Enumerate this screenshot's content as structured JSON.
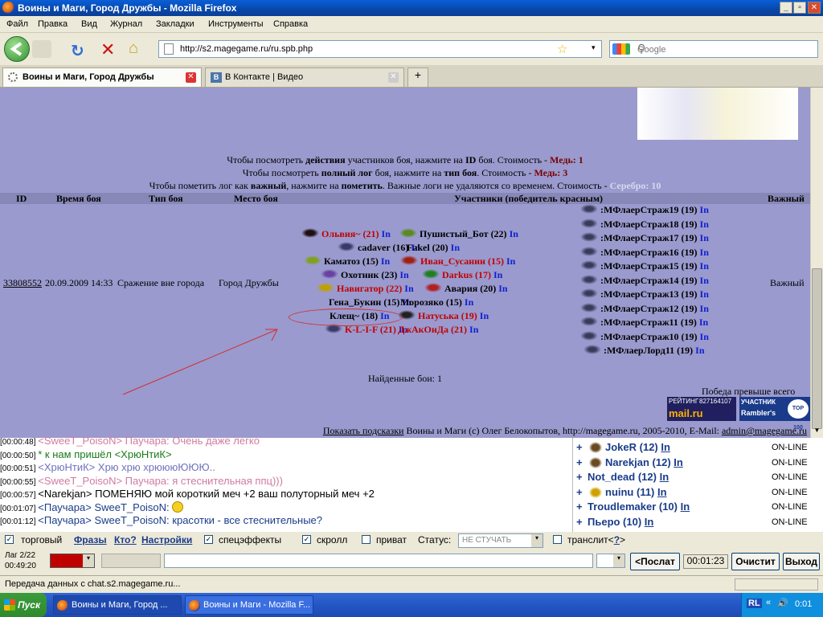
{
  "window": {
    "title": "Воины и Маги, Город Дружбы - Mozilla Firefox"
  },
  "menu": [
    "Файл",
    "Правка",
    "Вид",
    "Журнал",
    "Закладки",
    "Инструменты",
    "Справка"
  ],
  "nav": {
    "url": "http://s2.magegame.ru/ru.spb.php",
    "search_placeholder": "Google"
  },
  "tabs": [
    {
      "label": "Воины и Маги, Город Дружбы"
    },
    {
      "label": "В Контакте | Видео"
    }
  ],
  "game": {
    "info1": {
      "pre": "Чтобы посмотреть ",
      "b1": "действия",
      "mid": " участников боя, нажмите на ",
      "b2": "ID",
      "post": " боя. Стоимость - ",
      "cost": "Медь: 1"
    },
    "info2": {
      "pre": "Чтобы посмотреть ",
      "b1": "полный лог",
      "mid": " боя, нажмите на ",
      "b2": "тип боя",
      "post": ". Стоимость - ",
      "cost": "Медь: 3"
    },
    "info3": {
      "pre": "Чтобы пометить лог как ",
      "b1": "важный",
      "mid": ", нажмите на ",
      "b2": "пометить",
      "post": ". Важные логи не удаляются со временем. Стоимость - ",
      "cost": "Серебро: 10"
    },
    "headers": {
      "id": "ID",
      "time": "Время боя",
      "type": "Тип боя",
      "place": "Место боя",
      "members": "Участники (победитель красным)",
      "important": "Важный"
    },
    "row": {
      "id": "33808552",
      "time": "20.09.2009 14:33",
      "type": "Сражение вне города",
      "place": "Город Дружбы",
      "important": "Важный"
    },
    "fighters": [
      {
        "name": "Ольвия~",
        "level": "(21)",
        "red": true
      },
      {
        "name": "Пушистый_Бот",
        "level": "(22)",
        "red": false
      },
      {
        "name": "cadaver",
        "level": "(16)",
        "red": false
      },
      {
        "name": "Fakel",
        "level": "(20)",
        "red": false
      },
      {
        "name": "Каматоз",
        "level": "(15)",
        "red": false
      },
      {
        "name": "Иван_Сусанин",
        "level": "(15)",
        "red": true
      },
      {
        "name": "Охотник",
        "level": "(23)",
        "red": false
      },
      {
        "name": "Darkus",
        "level": "(17)",
        "red": true
      },
      {
        "name": "Навигатор",
        "level": "(22)",
        "red": true
      },
      {
        "name": "Авария",
        "level": "(20)",
        "red": false
      },
      {
        "name": "Гена_Букин",
        "level": "(15)",
        "red": false
      },
      {
        "name": "Морозяко",
        "level": "(15)",
        "red": false
      },
      {
        "name": "Клещ~",
        "level": "(18)",
        "red": false
      },
      {
        "name": "Натуська",
        "level": "(19)",
        "red": true
      },
      {
        "name": "K-L-I-F",
        "level": "(21)",
        "red": true
      },
      {
        "name": "ДжАкОнДа",
        "level": "(21)",
        "red": true
      }
    ],
    "link_in": "In",
    "guards": [
      {
        "name": ":МФлаерСтраж19",
        "level": "(19)"
      },
      {
        "name": ":МФлаерСтраж18",
        "level": "(19)"
      },
      {
        "name": ":МФлаерСтраж17",
        "level": "(19)"
      },
      {
        "name": ":МФлаерСтраж16",
        "level": "(19)"
      },
      {
        "name": ":МФлаерСтраж15",
        "level": "(19)"
      },
      {
        "name": ":МФлаерСтраж14",
        "level": "(19)"
      },
      {
        "name": ":МФлаерСтраж13",
        "level": "(19)"
      },
      {
        "name": ":МФлаерСтраж12",
        "level": "(19)"
      },
      {
        "name": ":МФлаерСтраж11",
        "level": "(19)"
      },
      {
        "name": ":МФлаерСтраж10",
        "level": "(19)"
      },
      {
        "name": ":МФлаерЛорд11",
        "level": "(19)"
      }
    ],
    "found": "Найденные бои: 1",
    "win_text": "Победа превыше всего",
    "mailru": {
      "label": "РЕЙТИНГ",
      "num": "827164107",
      "brand": "mail.ru"
    },
    "rambler": {
      "top": "УЧАСТНИК",
      "brand": "Rambler's",
      "badge": "TOP 100"
    },
    "footer": {
      "link": "Показать подсказки",
      "text": " Воины и Маги (c) Олег Белокопытов, http://magegame.ru, 2005-2010, E-Mail: ",
      "email": "admin@magegame.ru"
    }
  },
  "chat": [
    {
      "ts": "[00:00:48]",
      "nick": "<SweeT_PoisoN>",
      "text": " Паучара: Очень даже легко",
      "color": "#d07aa0"
    },
    {
      "ts": "[00:00:50]",
      "nick": "",
      "text": "* к нам пришёл <ХрюНтиК>",
      "color": "#1a7a1a"
    },
    {
      "ts": "[00:00:51]",
      "nick": "<ХрюНтиК>",
      "text": " Хрю хрю хрюююЮЮЮ..",
      "color": "#7070c0"
    },
    {
      "ts": "[00:00:55]",
      "nick": "<SweeT_PoisoN>",
      "text": " Паучара: я стеснительная ппц)))",
      "color": "#d07aa0"
    },
    {
      "ts": "[00:00:57]",
      "nick": "<Narekjan>",
      "text": " ПОМЕНЯЮ мой короткий меч +2 ваш полуторный меч +2",
      "color": "#000"
    },
    {
      "ts": "[00:01:07]",
      "nick": "<Паучара>",
      "text": " SweeT_PoisoN: ",
      "color": "#1a3c8a"
    },
    {
      "ts": "[00:01:12]",
      "nick": "<Паучара>",
      "text": " SweeT_PoisoN: красотки - все стеснительные?",
      "color": "#1a3c8a"
    }
  ],
  "users": [
    {
      "name": "JokeR",
      "level": "(12)",
      "status": "ON-LINE"
    },
    {
      "name": "Narekjan",
      "level": "(12)",
      "status": "ON-LINE"
    },
    {
      "name": "Not_dead",
      "level": "(12)",
      "status": "ON-LINE"
    },
    {
      "name": "nuinu",
      "level": "(11)",
      "status": "ON-LINE"
    },
    {
      "name": "Troudlemaker",
      "level": "(10)",
      "status": "ON-LINE"
    },
    {
      "name": "Пьеро",
      "level": "(10)",
      "status": "ON-LINE"
    }
  ],
  "options": {
    "trade": "торговый",
    "phrases": "Фразы",
    "who": "Кто?",
    "settings": "Настройки",
    "effects": "спецэффекты",
    "scroll": "скролл",
    "private": "приват",
    "status_label": "Статус:",
    "status_value": "НЕ СТУЧАТЬ",
    "translit": "транслит<",
    "translit_q": "?",
    "translit_end": ">"
  },
  "cmd": {
    "lag": "Лаг 2/22",
    "clock": "00:49:20",
    "send": "<Послат",
    "timer": "00:01:23",
    "clear": "Очистит",
    "exit": "Выход"
  },
  "status": "Передача данных с chat.s2.magegame.ru...",
  "taskbar": {
    "start": "Пуск",
    "tasks": [
      "Воины и Маги, Город ...",
      "Воины и Маги - Mozilla F..."
    ],
    "lang": "RL",
    "time": "0:01"
  },
  "colors": {
    "game_bg": "#9a9ace",
    "winner": "#c00000",
    "link": "#1020d0"
  }
}
